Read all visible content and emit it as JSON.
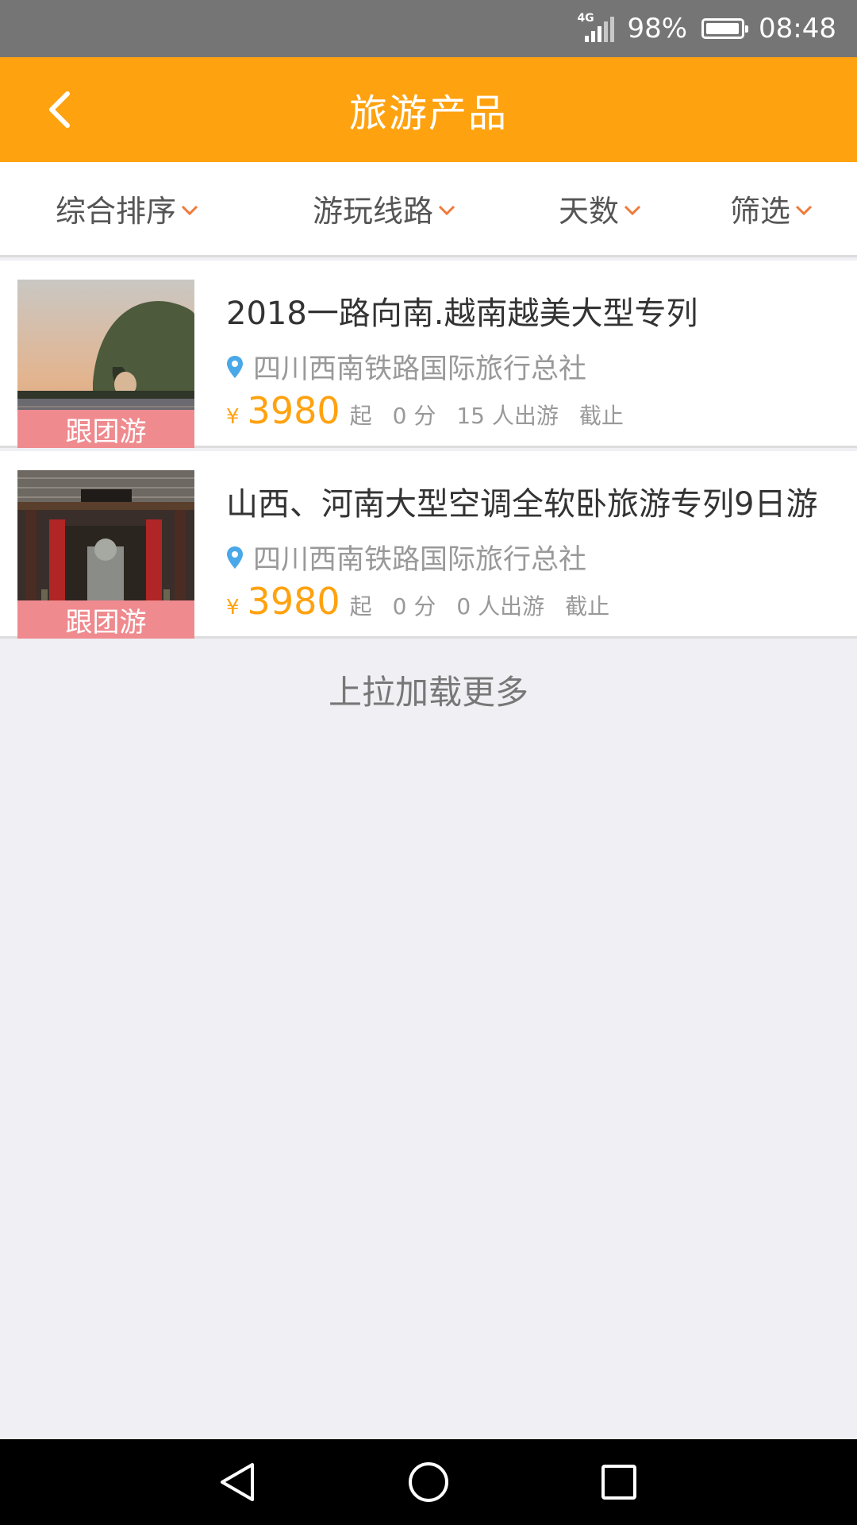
{
  "status_bar": {
    "network": "4G",
    "battery": "98%",
    "battery_level": 0.98,
    "time": "08:48"
  },
  "header": {
    "title": "旅游产品"
  },
  "filters": [
    {
      "label": "综合排序"
    },
    {
      "label": "游玩线路"
    },
    {
      "label": "天数"
    },
    {
      "label": "筛选"
    }
  ],
  "products": [
    {
      "title": "2018一路向南.越南越美大型专列",
      "tag": "跟团游",
      "agency": "四川西南铁路国际旅行总社",
      "currency": "¥",
      "price": "3980",
      "price_suffix": "起",
      "score": "0 分",
      "travelers": "15 人出游",
      "deadline": "截止"
    },
    {
      "title": "山西、河南大型空调全软卧旅游专列9日游",
      "tag": "跟团游",
      "agency": "四川西南铁路国际旅行总社",
      "currency": "¥",
      "price": "3980",
      "price_suffix": "起",
      "score": "0 分",
      "travelers": "0 人出游",
      "deadline": "截止"
    }
  ],
  "load_more": "上拉加载更多",
  "colors": {
    "accent": "#ffa210",
    "tag_bg": "#ef8a8e",
    "chevron": "#f07a3a",
    "location_pin": "#4aa8e8"
  }
}
